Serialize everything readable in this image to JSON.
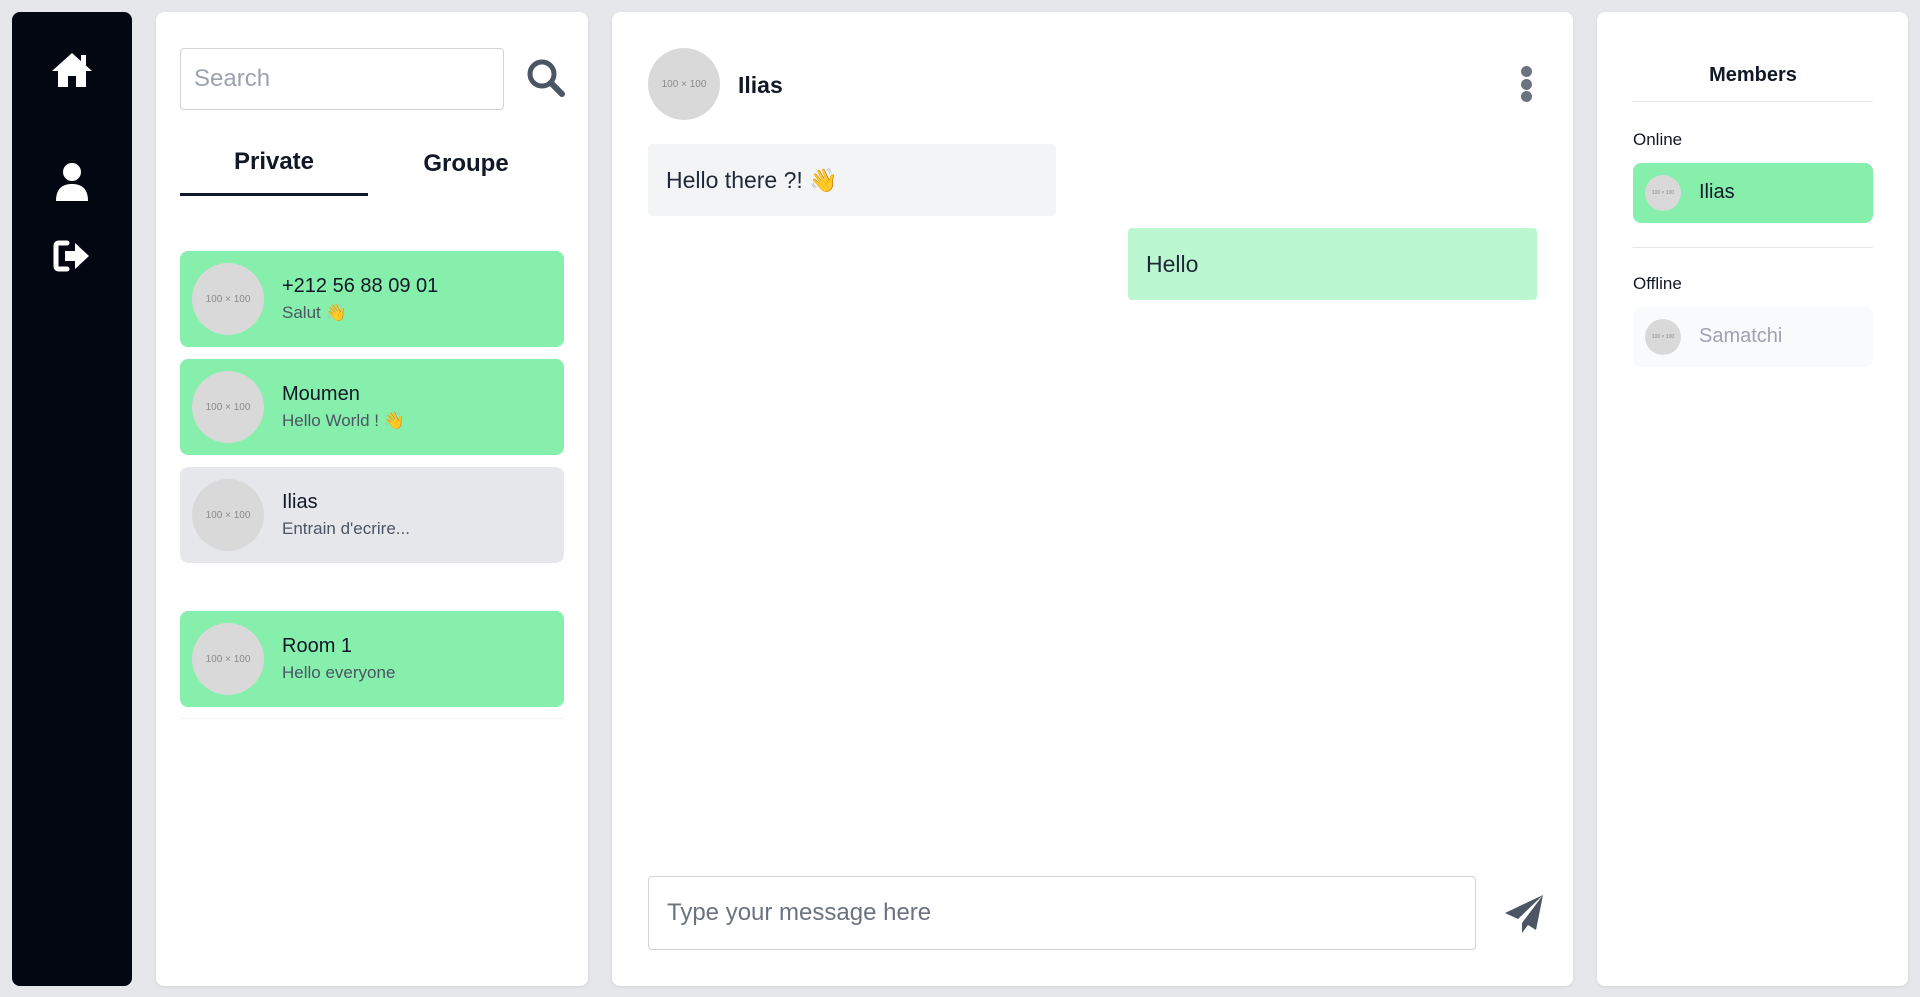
{
  "nav": {
    "icons": [
      "home-icon",
      "user-icon",
      "logout-icon"
    ],
    "color": "#030712"
  },
  "contacts": {
    "search_placeholder": "Search",
    "tabs": [
      {
        "label": "Private",
        "active": true
      },
      {
        "label": "Groupe",
        "active": false
      }
    ],
    "conversations": [
      {
        "avatar": "100 × 100",
        "name": "+212 56 88 09 01",
        "preview": "Salut 👋",
        "highlight": "#86efac"
      },
      {
        "avatar": "100 × 100",
        "name": "Moumen",
        "preview": "Hello World ! 👋",
        "highlight": "#86efac"
      },
      {
        "avatar": "100 × 100",
        "name": "Ilias",
        "preview": "Entrain d'ecrire...",
        "highlight": "#e5e7eb"
      }
    ],
    "groups": [
      {
        "avatar": "100 × 100",
        "name": "Room 1",
        "preview": "Hello everyone",
        "highlight": "#86efac"
      }
    ]
  },
  "chat": {
    "avatar": "100 × 100",
    "name": "Ilias",
    "messages": [
      {
        "direction": "incoming",
        "text": "Hello there ?! 👋"
      },
      {
        "direction": "outgoing",
        "text": "Hello"
      }
    ],
    "input_placeholder": "Type your message here"
  },
  "members": {
    "title": "Members",
    "online_label": "Online",
    "offline_label": "Offline",
    "online": [
      {
        "name": "Ilias",
        "avatar": "100 × 100"
      }
    ],
    "offline": [
      {
        "name": "Samatchi",
        "avatar": "100 × 100"
      }
    ]
  },
  "colors": {
    "accent_green": "#86efac",
    "outgoing_bubble": "#bbf7d0",
    "incoming_bubble": "#f3f4f6",
    "sidebar": "#030712"
  }
}
